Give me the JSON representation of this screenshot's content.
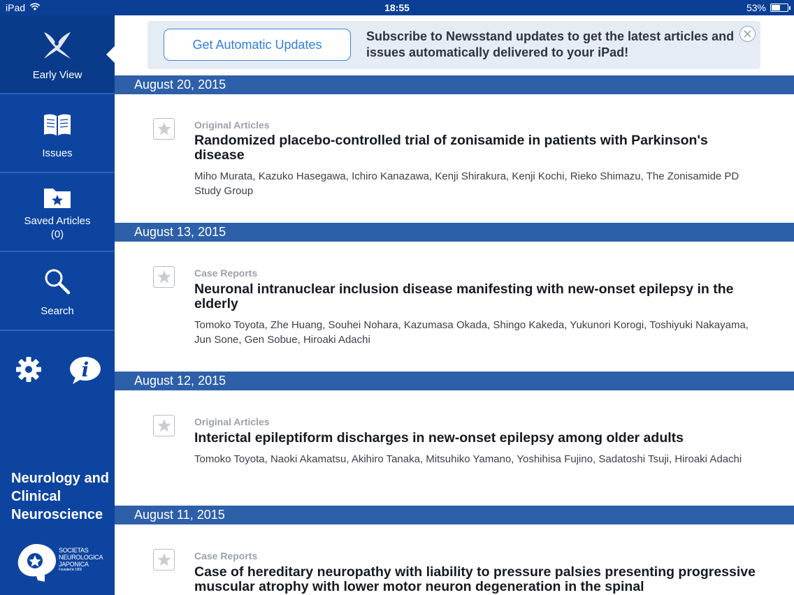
{
  "status_bar": {
    "device": "iPad",
    "time": "18:55",
    "battery_text": "53%",
    "battery_level": 0.53,
    "wifi_icon": "wifi-icon"
  },
  "sidebar": {
    "nav": [
      {
        "label": "Early View",
        "icon": "early-view-icon",
        "active": true
      },
      {
        "label": "Issues",
        "icon": "book-icon",
        "active": false
      },
      {
        "label": "Saved Articles",
        "count": "(0)",
        "icon": "saved-folder-icon",
        "active": false
      },
      {
        "label": "Search",
        "icon": "search-icon",
        "active": false
      }
    ],
    "settings_icon": "gear-icon",
    "info_icon": "info-icon",
    "journal": {
      "line1": "Neurology and",
      "line2": "Clinical",
      "line3": "Neuroscience"
    },
    "society": {
      "line1": "SOCIETAS",
      "line2": "NEUROLOGICA",
      "line3": "JAPONICA",
      "founded": "Founded in 1902"
    },
    "colors": {
      "sidebar_bg": "#0d44a0",
      "active_bg": "#0a3b8a"
    }
  },
  "banner": {
    "button_label": "Get Automatic Updates",
    "message": "Subscribe to Newsstand updates to get the latest articles and issues automatically delivered to your iPad!",
    "close_icon": "close-icon"
  },
  "feed": [
    {
      "date": "August 20, 2015",
      "category": "Original Articles",
      "title": "Randomized placebo-controlled trial of zonisamide in patients with Parkinson's disease",
      "authors": "Miho Murata, Kazuko Hasegawa, Ichiro Kanazawa, Kenji Shirakura, Kenji Kochi, Rieko Shimazu, The Zonisamide PD Study Group"
    },
    {
      "date": "August 13, 2015",
      "category": "Case Reports",
      "title": "Neuronal intranuclear inclusion disease manifesting with new-onset epilepsy in the elderly",
      "authors": "Tomoko Toyota, Zhe Huang, Souhei Nohara, Kazumasa Okada, Shingo Kakeda, Yukunori Korogi, Toshiyuki Nakayama, Jun Sone, Gen Sobue, Hiroaki Adachi"
    },
    {
      "date": "August 12, 2015",
      "category": "Original Articles",
      "title": "Interictal epileptiform discharges in new-onset epilepsy among older adults",
      "authors": "Tomoko Toyota, Naoki Akamatsu, Akihiro Tanaka, Mitsuhiko Yamano, Yoshihisa Fujino, Sadatoshi Tsuji, Hiroaki Adachi"
    },
    {
      "date": "August 11, 2015",
      "category": "Case Reports",
      "title": "Case of hereditary neuropathy with liability to pressure palsies presenting progressive muscular atrophy with lower motor neuron degeneration in the spinal",
      "authors": ""
    }
  ],
  "colors": {
    "date_header": "#2e60a9",
    "banner_bg": "#e6ecf4",
    "button_text": "#2f7fe0"
  }
}
